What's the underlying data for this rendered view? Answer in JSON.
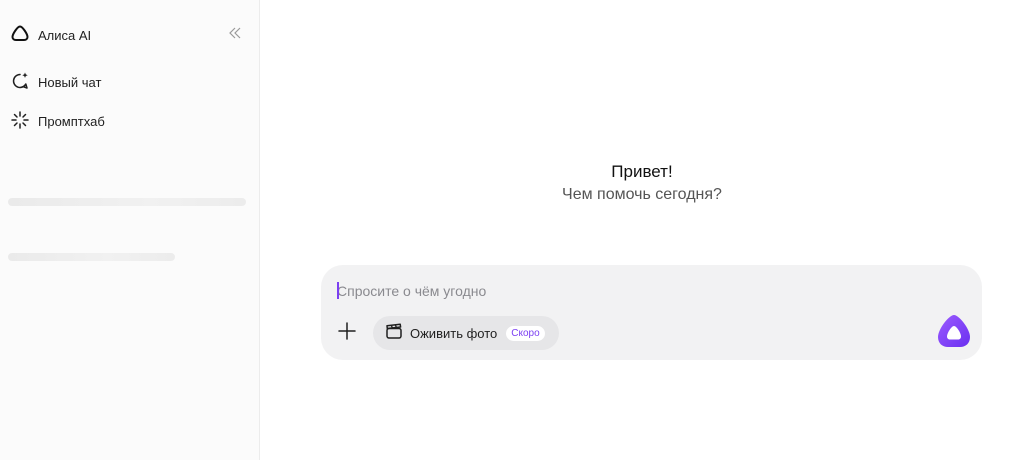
{
  "sidebar": {
    "brand": {
      "name": "Алиса AI",
      "icon": "alice-logo-icon"
    },
    "collapse_icon": "collapse-double-chevron-left-icon",
    "items": [
      {
        "label": "Новый чат",
        "icon": "new-chat-bubble-icon"
      },
      {
        "label": "Промптхаб",
        "icon": "sparkle-burst-icon"
      }
    ]
  },
  "main": {
    "greeting": {
      "title": "Привет!",
      "subtitle": "Чем помочь сегодня?"
    },
    "composer": {
      "placeholder": "Спросите о чём угодно",
      "value": "",
      "attach_icon": "plus-icon",
      "chip": {
        "label": "Оживить фото",
        "badge": "Скоро",
        "icon": "clapperboard-icon"
      },
      "send_icon": "alice-send-icon"
    }
  },
  "colors": {
    "accent": "#7b3ff2",
    "sidebar_bg": "#fbfbfb",
    "composer_bg": "#f2f2f3",
    "chip_bg": "#e6e6e8"
  }
}
